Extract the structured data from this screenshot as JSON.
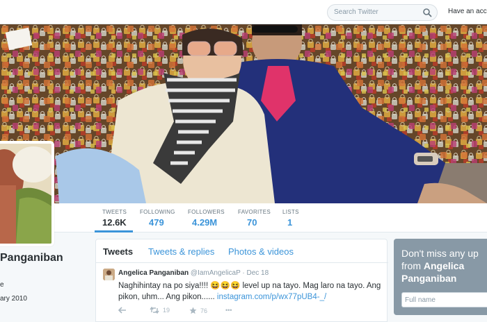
{
  "header": {
    "search_placeholder": "Search Twitter",
    "account_link": "Have an accou"
  },
  "profile": {
    "name": "Panganiban",
    "line1": "e",
    "line2": "ary 2010"
  },
  "stats": [
    {
      "label": "TWEETS",
      "value": "12.6K"
    },
    {
      "label": "FOLLOWING",
      "value": "479"
    },
    {
      "label": "FOLLOWERS",
      "value": "4.29M"
    },
    {
      "label": "FAVORITES",
      "value": "70"
    },
    {
      "label": "LISTS",
      "value": "1"
    }
  ],
  "tabs": [
    "Tweets",
    "Tweets & replies",
    "Photos & videos"
  ],
  "tweet": {
    "name": "Angelica Panganiban",
    "handle": "@IamAngelicaP",
    "separator": "·",
    "date": "Dec 18",
    "text": "Naghihintay na po siya!!!! 😆😆😆 level up na tayo. Mag laro na tayo. Ang pikon, uhm... Ang pikon...... ",
    "link": "instagram.com/p/wx77pUB4-_/",
    "retweets": "19",
    "favorites": "76",
    "more": "•••"
  },
  "cta": {
    "text": "Don't miss any up from ",
    "name": "Angelica Panganiban",
    "input_placeholder": "Full name"
  },
  "colors": {
    "link_blue": "#3b94d9",
    "text_dark": "#292f33",
    "muted": "#8899a6",
    "cta_bg": "#8899a6"
  }
}
